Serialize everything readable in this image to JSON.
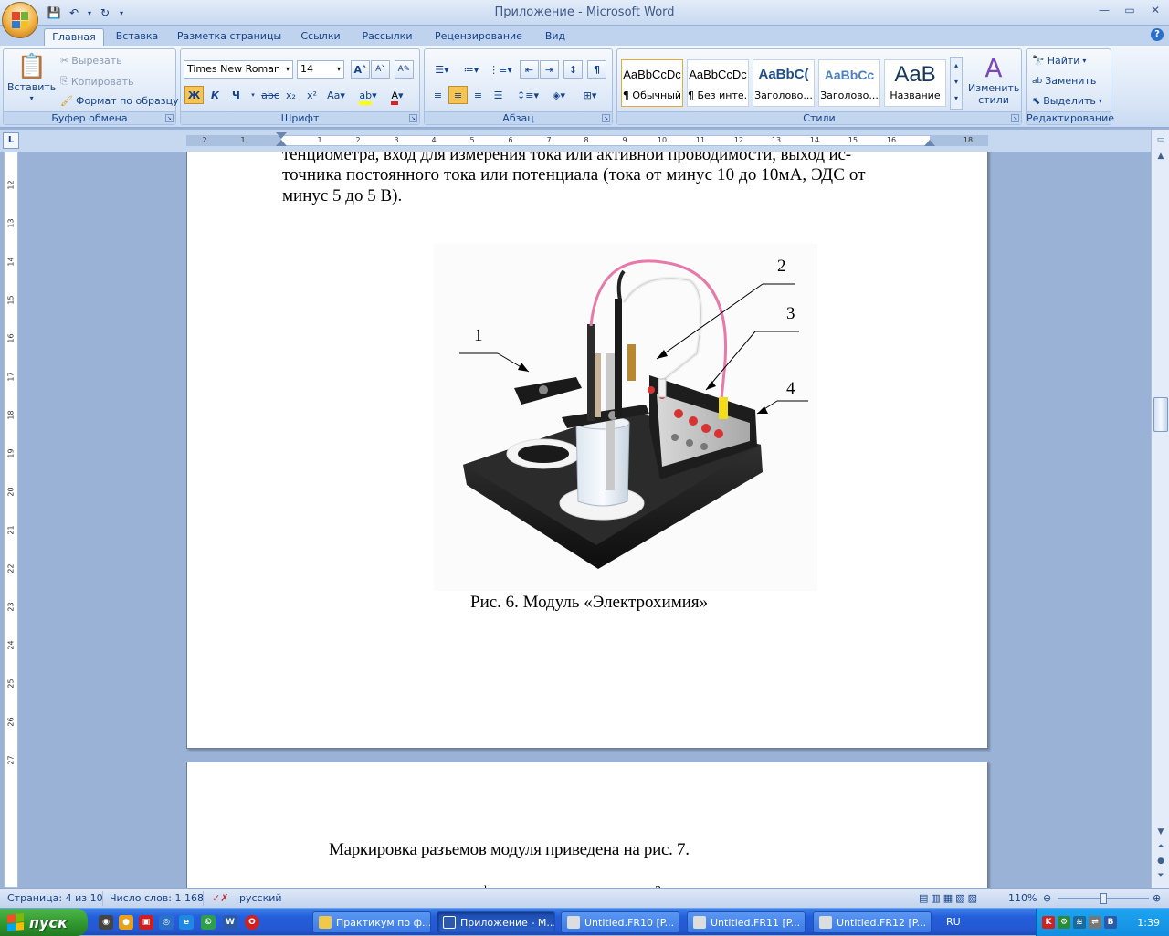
{
  "window": {
    "title": "Приложение - Microsoft Word"
  },
  "tabs": [
    "Главная",
    "Вставка",
    "Разметка страницы",
    "Ссылки",
    "Рассылки",
    "Рецензирование",
    "Вид"
  ],
  "active_tab": "Главная",
  "clipboard": {
    "paste": "Вставить",
    "cut": "Вырезать",
    "copy": "Копировать",
    "format_painter": "Формат по образцу",
    "group": "Буфер обмена"
  },
  "font": {
    "name": "Times New Roman",
    "size": "14",
    "group": "Шрифт",
    "bold": "Ж",
    "italic": "К",
    "underline": "Ч",
    "strike": "abc",
    "subscript": "x₂",
    "superscript": "x²",
    "change_case": "Аа",
    "grow": "A",
    "shrink": "A"
  },
  "paragraph": {
    "group": "Абзац",
    "show_marks": "¶"
  },
  "styles": {
    "group": "Стили",
    "items": [
      {
        "sample": "AaBbCcDc",
        "name": "¶ Обычный"
      },
      {
        "sample": "AaBbCcDc",
        "name": "¶ Без инте..."
      },
      {
        "sample": "AaBbC(",
        "name": "Заголово..."
      },
      {
        "sample": "AaBbCc",
        "name": "Заголово..."
      },
      {
        "sample": "AaB",
        "name": "Название"
      }
    ],
    "change": "Изменить стили"
  },
  "editing": {
    "group": "Редактирование",
    "find": "Найти",
    "replace": "Заменить",
    "select": "Выделить"
  },
  "ruler": {
    "h_numbers": [
      "2",
      "1",
      "1",
      "2",
      "3",
      "4",
      "5",
      "6",
      "7",
      "8",
      "9",
      "10",
      "11",
      "12",
      "13",
      "14",
      "15",
      "16",
      "18"
    ],
    "v_numbers": [
      "12",
      "13",
      "14",
      "15",
      "16",
      "17",
      "18",
      "19",
      "20",
      "21",
      "22",
      "23",
      "24",
      "25",
      "26",
      "27"
    ]
  },
  "page1": {
    "lines": [
      "тенциометра, вход для измерения тока или активной проводимости, выход ис-",
      "точника постоянного тока или потенциала (тока от минус 10 до  10мА, ЭДС от",
      "минус 5 до 5 В)."
    ],
    "figure_labels": [
      "1",
      "2",
      "3",
      "4"
    ],
    "caption": "Рис. 6. Модуль «Электрохимия»"
  },
  "page2": {
    "line": "Маркировка разъемов модуля приведена на рис. 7."
  },
  "status": {
    "page": "Страница: 4 из 10",
    "words": "Число слов: 1 168",
    "language": "русский",
    "zoom": "110%"
  },
  "taskbar": {
    "start": "пуск",
    "buttons": [
      "Практикум по ф...",
      "Приложение - М...",
      "Untitled.FR10 [P...",
      "Untitled.FR11 [P...",
      "Untitled.FR12 [P..."
    ],
    "lang": "RU",
    "clock": "1:39"
  }
}
